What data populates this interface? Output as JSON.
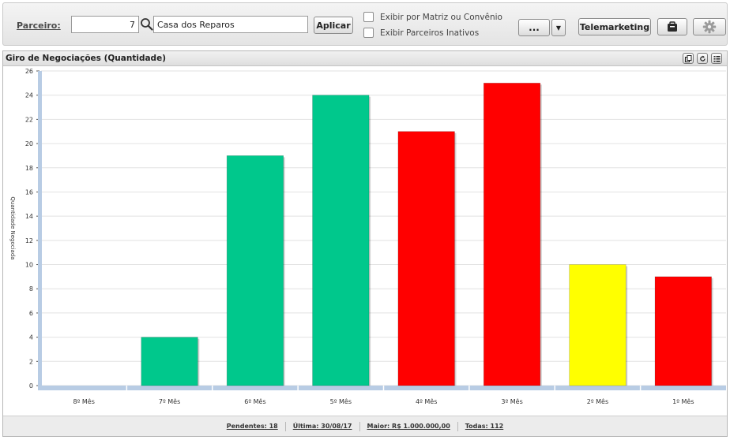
{
  "filter": {
    "parceiro_label": "Parceiro:",
    "parceiro_code": "7",
    "parceiro_name": "Casa dos Reparos",
    "aplicar_label": "Aplicar",
    "check_matriz_label": "Exibir por Matriz ou Convênio",
    "check_inativos_label": "Exibir Parceiros Inativos",
    "more_label": "...",
    "dropdown_glyph": "▼",
    "telemarketing_label": "Telemarketing"
  },
  "panel": {
    "title": "Giro de Negociações (Quantidade)",
    "header_icons": [
      "copy-icon",
      "refresh-icon",
      "settings-list-icon"
    ]
  },
  "chart_data": {
    "type": "bar",
    "title": "Giro de Negociações (Quantidade)",
    "ylabel": "Quantidade Negociada",
    "xlabel": "",
    "ylim": [
      0,
      26
    ],
    "yticks": [
      0,
      2,
      4,
      6,
      8,
      10,
      12,
      14,
      16,
      18,
      20,
      22,
      24,
      26
    ],
    "categories": [
      "8º Mês",
      "7º Mês",
      "6º Mês",
      "5º Mês",
      "4º Mês",
      "3º Mês",
      "2º Mês",
      "1º Mês"
    ],
    "values": [
      0,
      4,
      19,
      24,
      21,
      25,
      10,
      9
    ],
    "bar_colors": [
      "#00c88c",
      "#00c88c",
      "#00c88c",
      "#00c88c",
      "#ff0000",
      "#ff0000",
      "#ffff00",
      "#ff0000"
    ],
    "grid": true,
    "legend": "none"
  },
  "footer": {
    "pendentes": "Pendentes: 18",
    "ultima": "Última: 30/08/17",
    "maior": "Maior: R$ 1.000.000,00",
    "todas": "Todas: 112"
  },
  "colors": {
    "green": "#00c88c",
    "red": "#ff0000",
    "yellow": "#ffff00",
    "axis_strip": "#b8cce4"
  }
}
